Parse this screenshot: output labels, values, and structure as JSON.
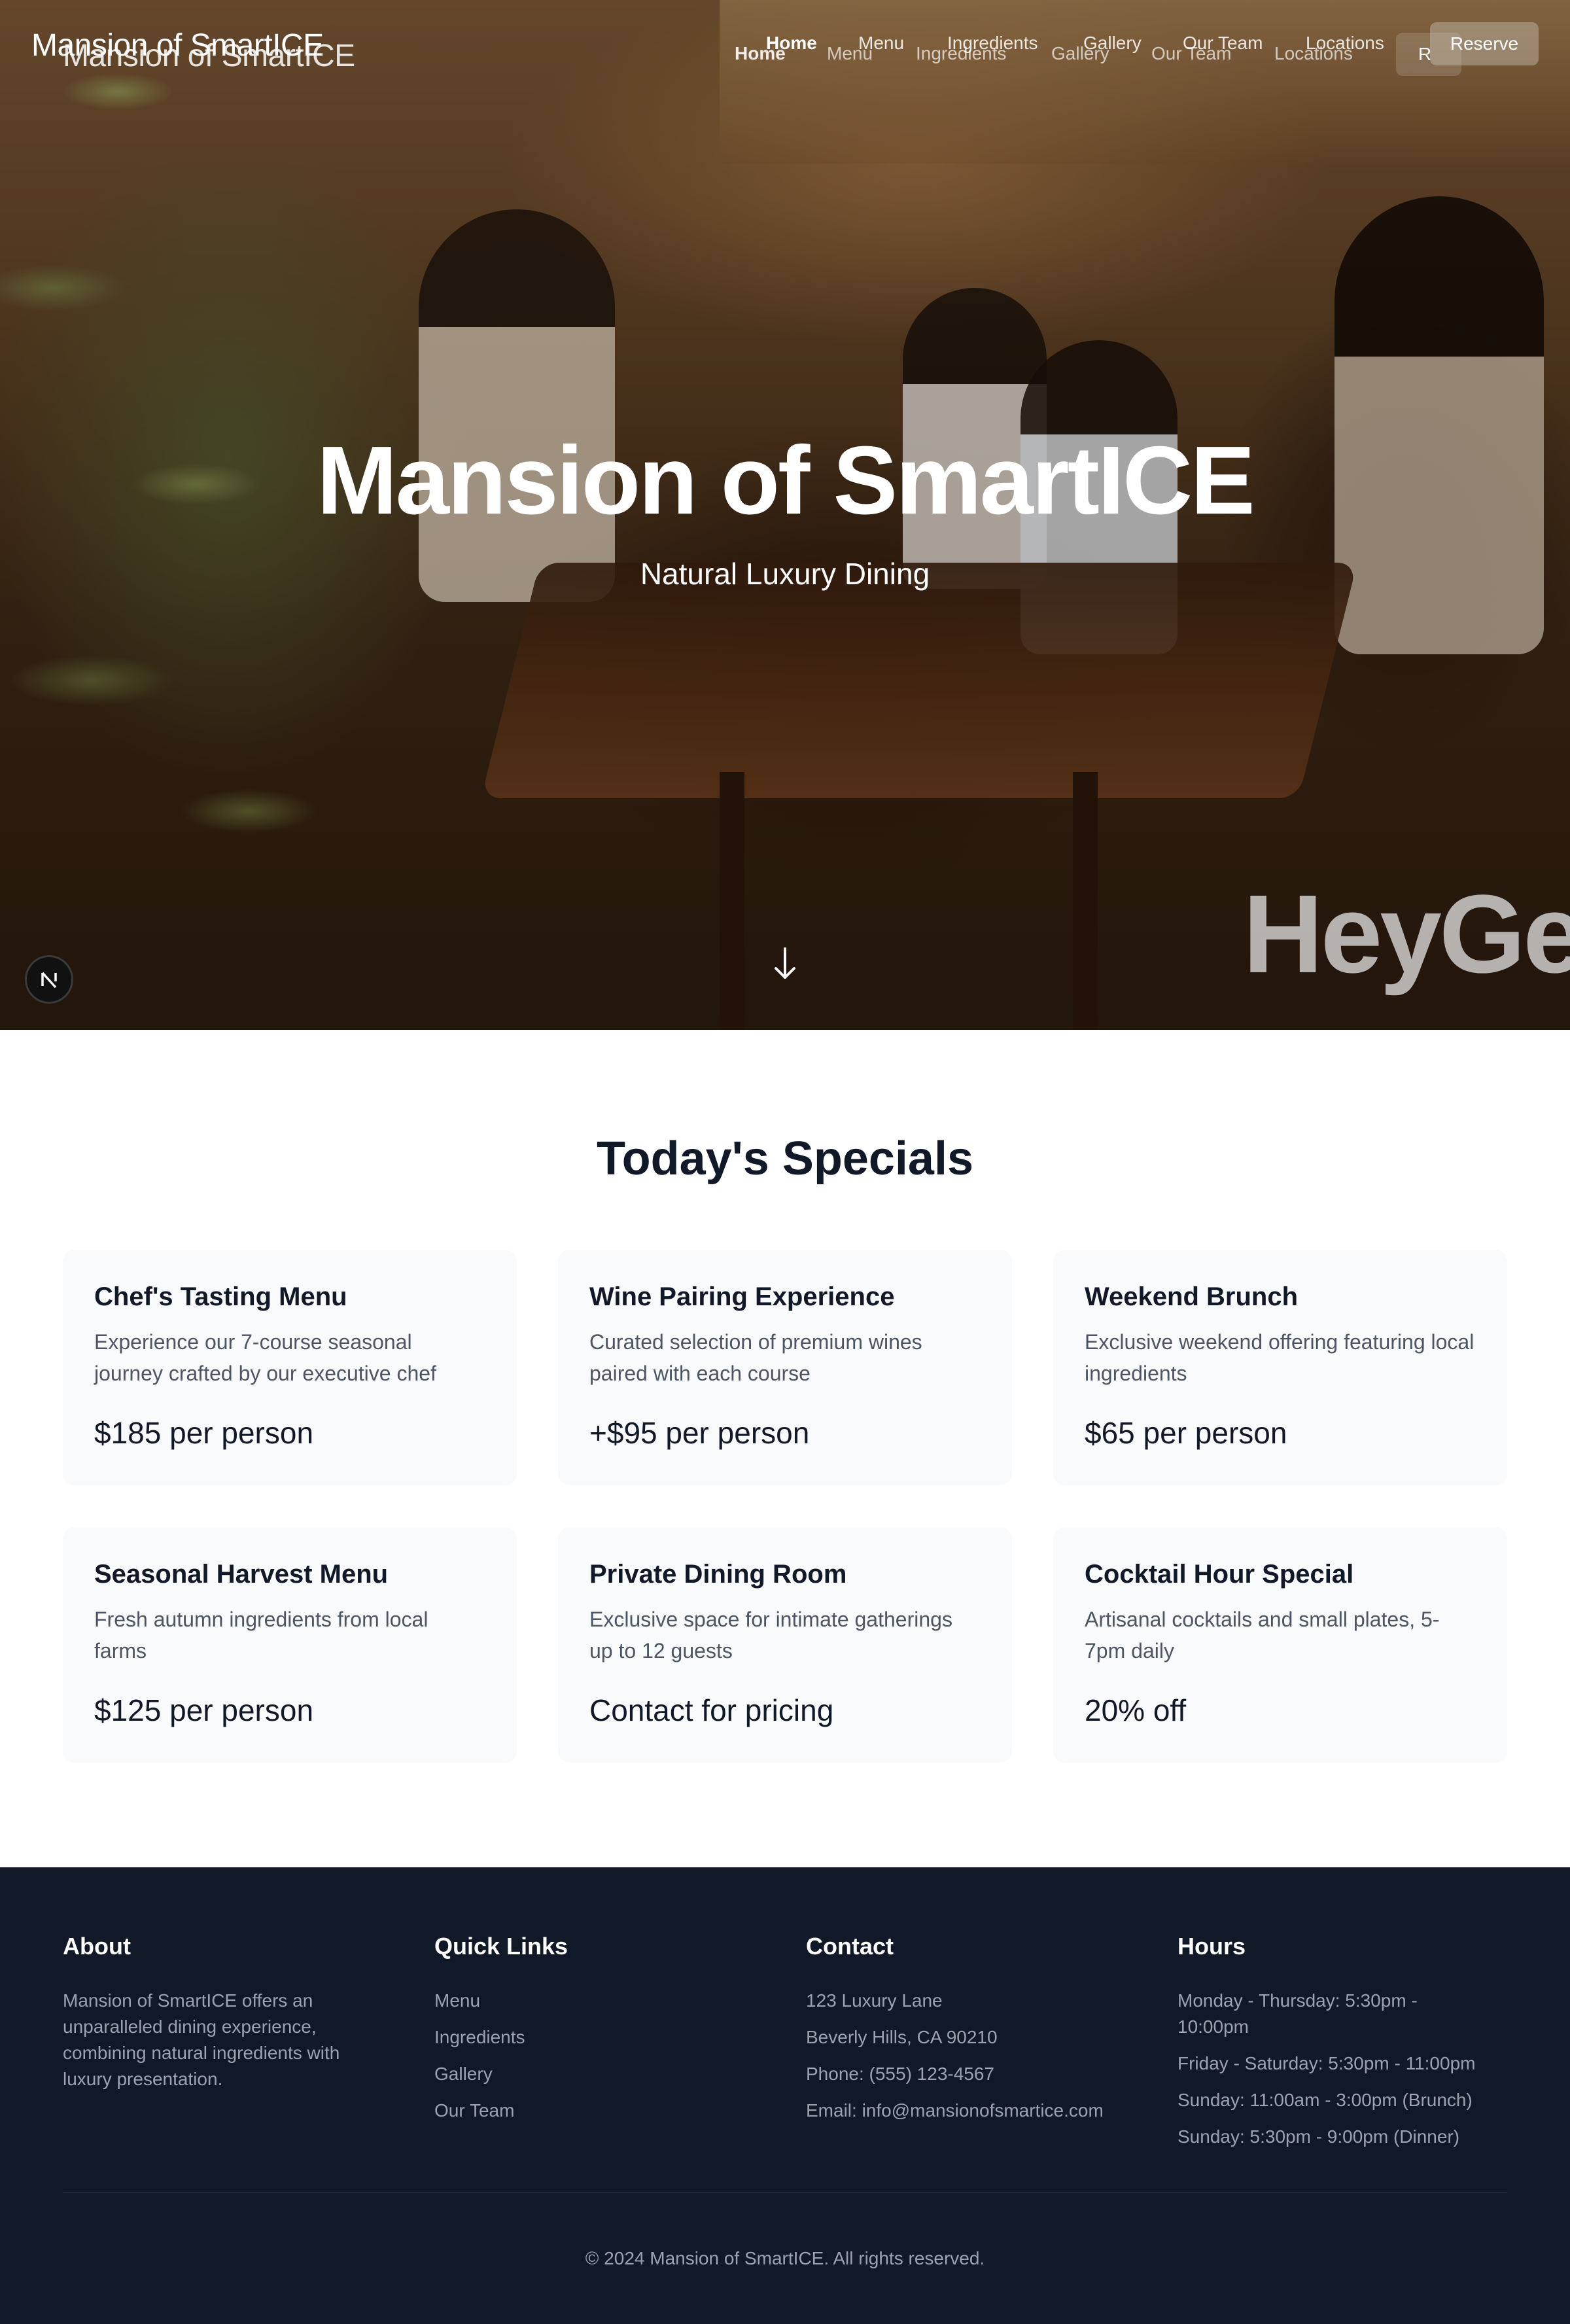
{
  "colors": {
    "primary_text": "#111827",
    "secondary_text": "#4b5563",
    "card_bg": "#f9fafb",
    "footer_bg": "#111827",
    "footer_text": "#9ca3af"
  },
  "header": {
    "brand": "Mansion of SmartICE",
    "nav": [
      {
        "label": "Home",
        "active": true
      },
      {
        "label": "Menu",
        "active": false
      },
      {
        "label": "Ingredients",
        "active": false
      },
      {
        "label": "Gallery",
        "active": false
      },
      {
        "label": "Our Team",
        "active": false
      },
      {
        "label": "Locations",
        "active": false
      }
    ],
    "reserve_label": "Reserve"
  },
  "hero": {
    "title": "Mansion of SmartICE",
    "subtitle": "Natural Luxury Dining",
    "watermark": "HeyGen",
    "scroll_icon": "arrow-down-icon"
  },
  "specials": {
    "title": "Today's Specials",
    "items": [
      {
        "title": "Chef's Tasting Menu",
        "description": "Experience our 7-course seasonal journey crafted by our executive chef",
        "price": "$185 per person"
      },
      {
        "title": "Wine Pairing Experience",
        "description": "Curated selection of premium wines paired with each course",
        "price": "+$95 per person"
      },
      {
        "title": "Weekend Brunch",
        "description": "Exclusive weekend offering featuring local ingredients",
        "price": "$65 per person"
      },
      {
        "title": "Seasonal Harvest Menu",
        "description": "Fresh autumn ingredients from local farms",
        "price": "$125 per person"
      },
      {
        "title": "Private Dining Room",
        "description": "Exclusive space for intimate gatherings up to 12 guests",
        "price": "Contact for pricing"
      },
      {
        "title": "Cocktail Hour Special",
        "description": "Artisanal cocktails and small plates, 5-7pm daily",
        "price": "20% off"
      }
    ]
  },
  "footer": {
    "about": {
      "heading": "About",
      "text": "Mansion of SmartICE offers an unparalleled dining experience, combining natural ingredients with luxury presentation."
    },
    "quick_links": {
      "heading": "Quick Links",
      "items": [
        "Menu",
        "Ingredients",
        "Gallery",
        "Our Team"
      ]
    },
    "contact": {
      "heading": "Contact",
      "items": [
        "123 Luxury Lane",
        "Beverly Hills, CA 90210",
        "Phone: (555) 123-4567",
        "Email: info@mansionofsmartice.com"
      ]
    },
    "hours": {
      "heading": "Hours",
      "items": [
        "Monday - Thursday: 5:30pm - 10:00pm",
        "Friday - Saturday: 5:30pm - 11:00pm",
        "Sunday: 11:00am - 3:00pm (Brunch)",
        "Sunday: 5:30pm - 9:00pm (Dinner)"
      ]
    },
    "copyright": "© 2024 Mansion of SmartICE. All rights reserved."
  }
}
